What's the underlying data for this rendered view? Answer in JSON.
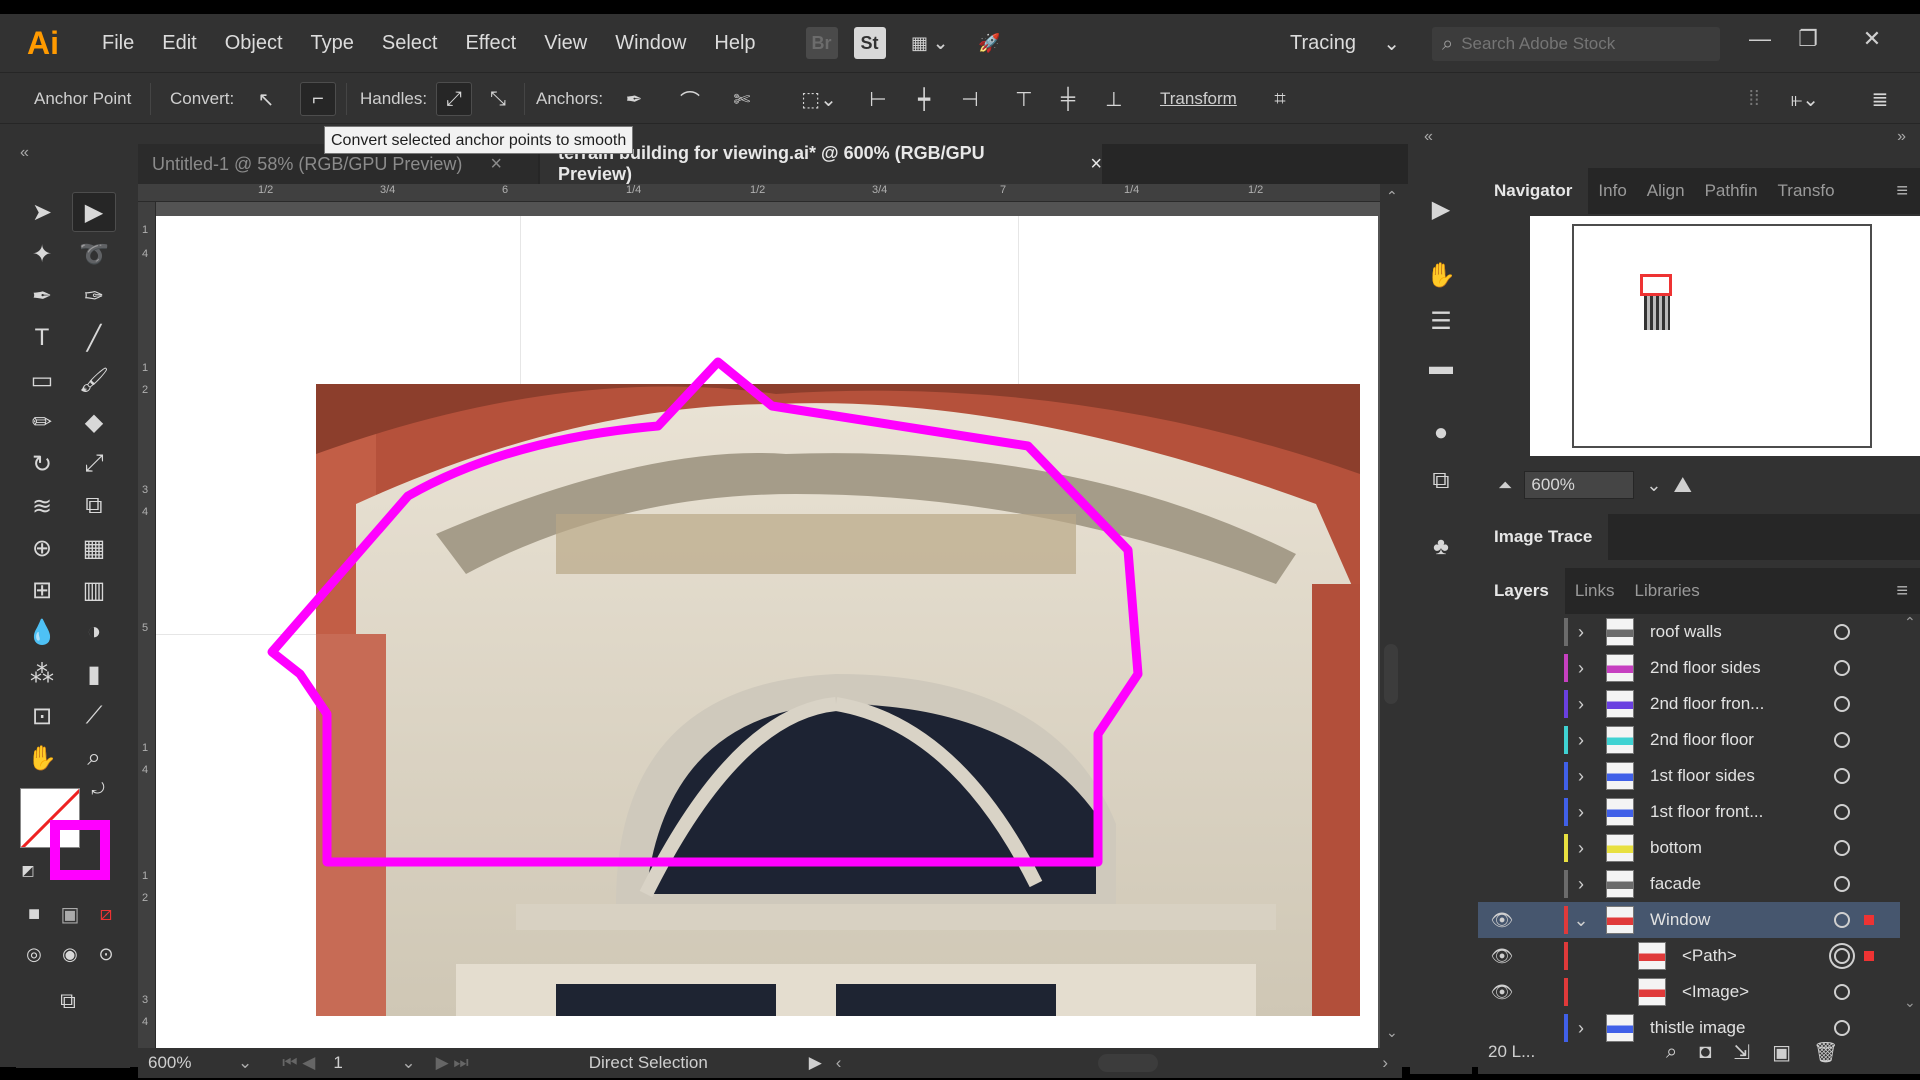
{
  "app": {
    "logo": "Ai",
    "menu": [
      "File",
      "Edit",
      "Object",
      "Type",
      "Select",
      "Effect",
      "View",
      "Window",
      "Help"
    ],
    "bridge_label": "Br",
    "stock_label": "St",
    "workspace": "Tracing",
    "search_placeholder": "Search Adobe Stock"
  },
  "control_bar": {
    "mode_label": "Anchor Point",
    "convert_label": "Convert:",
    "handles_label": "Handles:",
    "anchors_label": "Anchors:",
    "transform_label": "Transform",
    "tooltip": "Convert selected anchor points to smooth"
  },
  "tabs": [
    {
      "label": "Untitled-1 @ 58% (RGB/GPU Preview)",
      "close": "×"
    },
    {
      "label": "terrain building for viewing.ai* @ 600% (RGB/GPU Preview)",
      "close": "×"
    }
  ],
  "ruler": {
    "h_ticks": [
      "1/2",
      "3/4",
      "6",
      "1/4",
      "1/2",
      "3/4",
      "7",
      "1/4",
      "1/2"
    ],
    "v_ticks": [
      "1",
      "4",
      "1",
      "2",
      "3",
      "4",
      "5",
      "1",
      "4",
      "1",
      "2",
      "3",
      "4"
    ]
  },
  "status": {
    "zoom": "600%",
    "artboard": "1",
    "tool": "Direct Selection"
  },
  "navigator": {
    "tabs": [
      "Navigator",
      "Info",
      "Align",
      "Pathfin",
      "Transfo"
    ],
    "zoom": "600%"
  },
  "image_trace_title": "Image Trace",
  "layers_panel": {
    "tabs": [
      "Layers",
      "Links",
      "Libraries"
    ],
    "count": "20 L...",
    "layers": [
      {
        "name": "roof walls",
        "color": "#6b6b6b",
        "visible": false,
        "expanded": false,
        "indent": 0
      },
      {
        "name": "2nd floor sides",
        "color": "#c640c0",
        "visible": false,
        "expanded": false,
        "indent": 0
      },
      {
        "name": "2nd floor fron...",
        "color": "#6a40e0",
        "visible": false,
        "expanded": false,
        "indent": 0
      },
      {
        "name": "2nd floor floor",
        "color": "#3fd2d2",
        "visible": false,
        "expanded": false,
        "indent": 0
      },
      {
        "name": "1st floor sides",
        "color": "#4060e8",
        "visible": false,
        "expanded": false,
        "indent": 0
      },
      {
        "name": "1st floor front...",
        "color": "#4060e8",
        "visible": false,
        "expanded": false,
        "indent": 0
      },
      {
        "name": "bottom",
        "color": "#e8e040",
        "visible": false,
        "expanded": false,
        "indent": 0
      },
      {
        "name": "facade",
        "color": "#6b6b6b",
        "visible": false,
        "expanded": false,
        "indent": 0
      },
      {
        "name": "Window",
        "color": "#e03a3a",
        "visible": true,
        "expanded": true,
        "indent": 0,
        "selected": true
      },
      {
        "name": "<Path>",
        "color": "#e03a3a",
        "visible": true,
        "expanded": null,
        "indent": 1
      },
      {
        "name": "<Image>",
        "color": "#e03a3a",
        "visible": true,
        "expanded": null,
        "indent": 1
      },
      {
        "name": "thistle image",
        "color": "#4060e8",
        "visible": false,
        "expanded": false,
        "indent": 0
      }
    ]
  },
  "colors": {
    "accent_path": "#ff00ff",
    "app_bg": "#323232",
    "logo": "#ff9a00"
  }
}
